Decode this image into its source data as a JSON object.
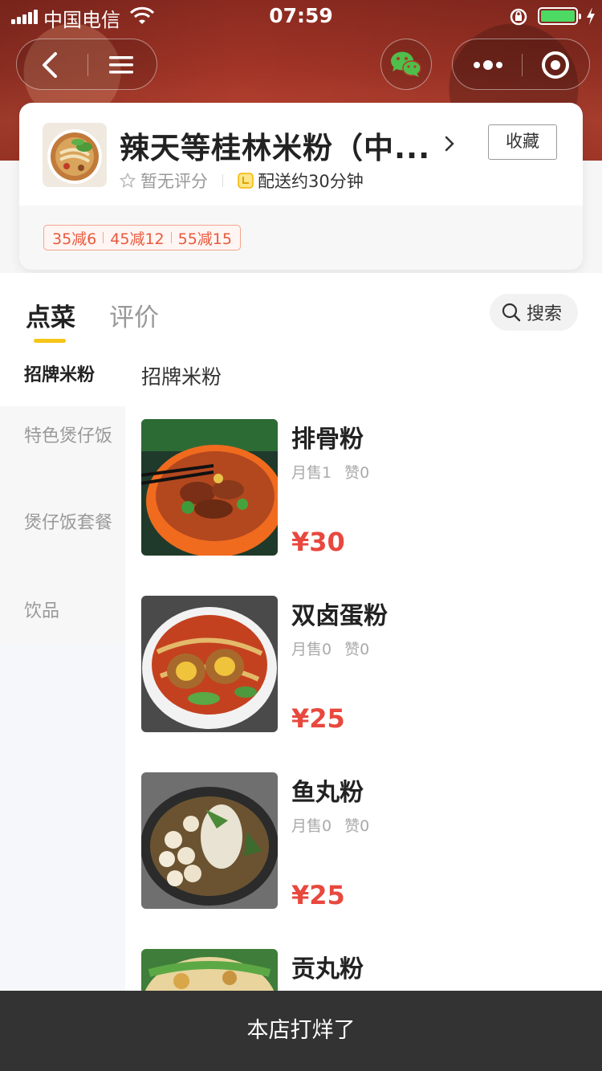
{
  "status_bar": {
    "carrier": "中国电信",
    "time": "07:59"
  },
  "shop": {
    "name": "辣天等桂林米粉（中...",
    "favorite_label": "收藏",
    "rating_text": "暂无评分",
    "delivery_text": "配送约30分钟",
    "discounts": [
      "35减6",
      "45减12",
      "55减15"
    ]
  },
  "tabs": {
    "order": "点菜",
    "review": "评价",
    "search": "搜索"
  },
  "categories": [
    {
      "label": "招牌米粉",
      "active": true
    },
    {
      "label": "特色煲仔饭",
      "active": false
    },
    {
      "label": "煲仔饭套餐",
      "active": false
    },
    {
      "label": "饮品",
      "active": false
    }
  ],
  "section_title": "招牌米粉",
  "dishes": [
    {
      "name": "排骨粉",
      "sales": "月售1",
      "likes": "赞0",
      "price": "¥30"
    },
    {
      "name": "双卤蛋粉",
      "sales": "月售0",
      "likes": "赞0",
      "price": "¥25"
    },
    {
      "name": "鱼丸粉",
      "sales": "月售0",
      "likes": "赞0",
      "price": "¥25"
    },
    {
      "name": "贡丸粉",
      "sales": "",
      "likes": "",
      "price": ""
    }
  ],
  "closed_notice": "本店打烊了",
  "colors": {
    "accent_yellow": "#f5c518",
    "price_red": "#e8483e",
    "discount_red": "#e9593d",
    "closed_bar": "#333333"
  }
}
